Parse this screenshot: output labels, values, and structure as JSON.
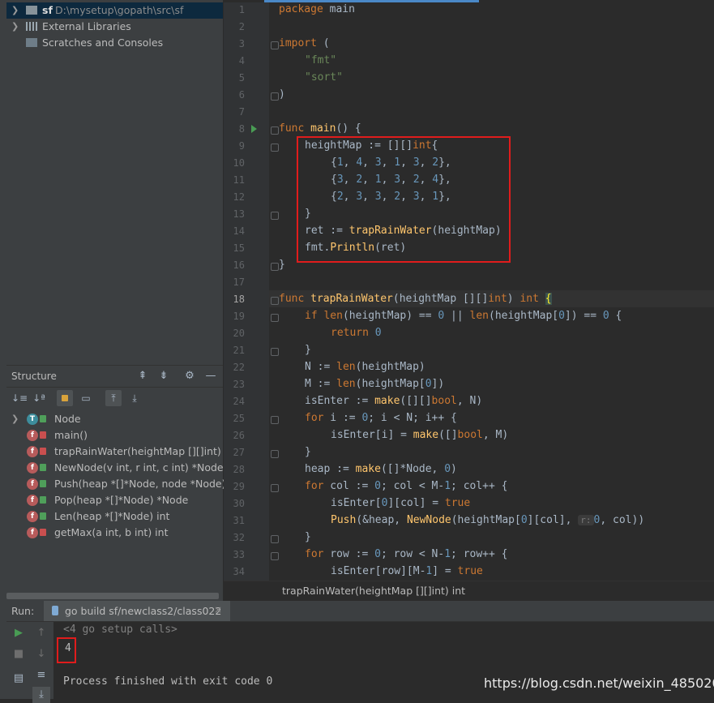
{
  "project": {
    "root_name": "sf",
    "root_path": "D:\\mysetup\\gopath\\src\\sf",
    "external_libraries": "External Libraries",
    "scratches": "Scratches and Consoles"
  },
  "structure": {
    "title": "Structure",
    "items": [
      {
        "badge": "T",
        "label": "Node"
      },
      {
        "badge": "f",
        "label": "main()"
      },
      {
        "badge": "f",
        "label": "trapRainWater(heightMap [][]int) int"
      },
      {
        "badge": "f",
        "label": "NewNode(v int, r int, c int) *Node"
      },
      {
        "badge": "f",
        "label": "Push(heap *[]*Node, node *Node)"
      },
      {
        "badge": "f",
        "label": "Pop(heap *[]*Node) *Node"
      },
      {
        "badge": "f",
        "label": "Len(heap *[]*Node) int"
      },
      {
        "badge": "f",
        "label": "getMax(a int, b int) int"
      }
    ]
  },
  "editor": {
    "current_line": "18",
    "lines": [
      "1",
      "2",
      "3",
      "4",
      "5",
      "6",
      "7",
      "8",
      "9",
      "10",
      "11",
      "12",
      "13",
      "14",
      "15",
      "16",
      "17",
      "18",
      "19",
      "20",
      "21",
      "22",
      "23",
      "24",
      "25",
      "26",
      "27",
      "28",
      "29",
      "30",
      "31",
      "32",
      "33",
      "34"
    ],
    "code": {
      "l1_kw": "package",
      "l1_rest": " main",
      "l3_kw": "import",
      "l3_rest": " (",
      "l4": "\"fmt\"",
      "l5": "\"sort\"",
      "l6": ")",
      "l8_kw": "func",
      "l8_fn": "main",
      "l8_rest": "() {",
      "l9_a": "heightMap := [][]",
      "l9_ty": "int",
      "l9_b": "{",
      "l10": [
        "1",
        "4",
        "3",
        "1",
        "3",
        "2"
      ],
      "l11": [
        "3",
        "2",
        "1",
        "3",
        "2",
        "4"
      ],
      "l12": [
        "2",
        "3",
        "3",
        "2",
        "3",
        "1"
      ],
      "l13": "}",
      "l14_a": "ret := ",
      "l14_fn": "trapRainWater",
      "l14_b": "(heightMap)",
      "l15_a": "fmt.",
      "l15_fn": "Println",
      "l15_b": "(ret)",
      "l16": "}",
      "l18_kw": "func",
      "l18_fn": "trapRainWater",
      "l18_a": "(heightMap [][]",
      "l18_ty": "int",
      "l18_b": ") ",
      "l18_ty2": "int",
      "l18_c": " ",
      "l18_brace": "{",
      "l19": "if len(heightMap) == 0 || len(heightMap[0]) == 0 {",
      "l20": "return 0",
      "l21": "}",
      "l22": "N := len(heightMap)",
      "l23": "M := len(heightMap[0])",
      "l24": "isEnter := make([][]bool, N)",
      "l25": "for i := 0; i < N; i++ {",
      "l26": "isEnter[i] = make([]bool, M)",
      "l27": "}",
      "l28": "heap := make([]*Node, 0)",
      "l29": "for col := 0; col < M-1; col++ {",
      "l30": "isEnter[0][col] = true",
      "l31_a": "Push(&heap, NewNode(heightMap[0][col], ",
      "l31_hint": "r:",
      "l31_b": " 0, col))",
      "l32": "}",
      "l33": "for row := 0; row < N-1; row++ {",
      "l34": "isEnter[row][M-1] = true"
    }
  },
  "breadcrumb": "trapRainWater(heightMap [][]int) int",
  "run": {
    "label": "Run:",
    "tab_label": "go build sf/newclass2/class022",
    "close": "×",
    "out_collapsed": "<4 go setup calls>",
    "out_result": "4",
    "out_exit": "Process finished with exit code 0"
  },
  "watermark": "https://blog.csdn.net/weixin_48502062"
}
